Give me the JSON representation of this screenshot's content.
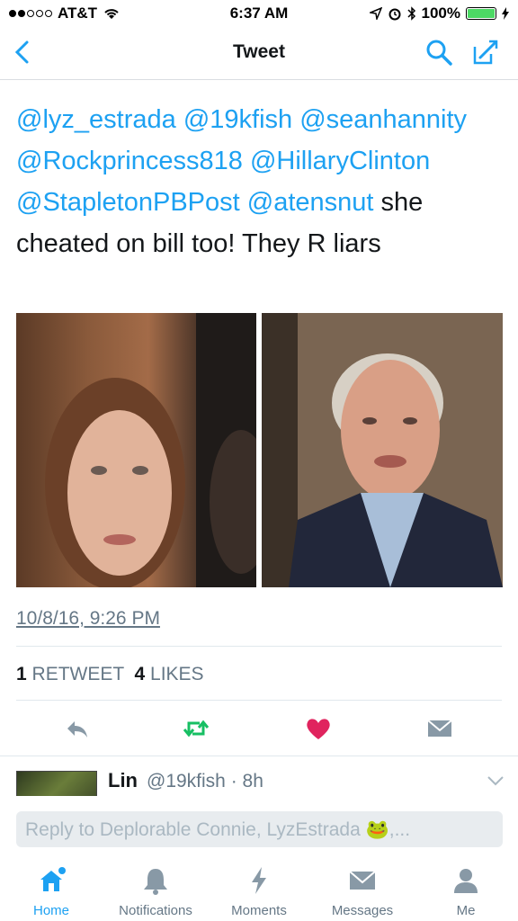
{
  "status_bar": {
    "carrier": "AT&T",
    "time": "6:37 AM",
    "battery": "100%"
  },
  "nav": {
    "title": "Tweet"
  },
  "tweet": {
    "mentions": [
      "@lyz_estrada",
      "@19kfish",
      "@seanhannity",
      "@Rockprincess818",
      "@HillaryClinton",
      "@StapletonPBPost",
      "@atensnut"
    ],
    "text": "she cheated on bill too! They R liars",
    "timestamp": "10/8/16, 9:26 PM",
    "retweets_count": "1",
    "retweets_label": "RETWEET",
    "likes_count": "4",
    "likes_label": "LIKES"
  },
  "reply_preview": {
    "name": "Lin",
    "handle": "@19kfish · 8h"
  },
  "reply_box": {
    "placeholder": "Reply to Deplorable Connie, LyzEstrada 🐸,..."
  },
  "tabs": [
    {
      "label": "Home"
    },
    {
      "label": "Notifications"
    },
    {
      "label": "Moments"
    },
    {
      "label": "Messages"
    },
    {
      "label": "Me"
    }
  ],
  "colors": {
    "accent": "#1da1f2",
    "like": "#e0245e",
    "retweet": "#17bf63"
  }
}
